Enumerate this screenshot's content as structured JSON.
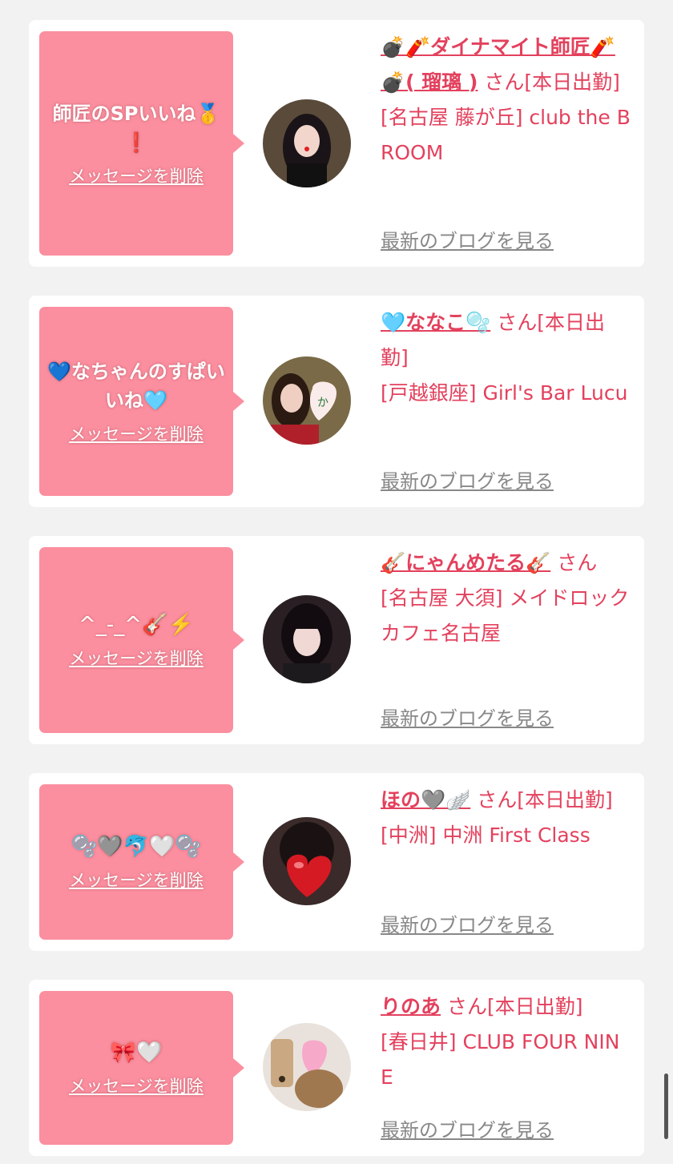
{
  "items": [
    {
      "message": "師匠のSPいいね🥇❗️",
      "delete_label": "メッセージを削除",
      "name": "💣🧨ダイナマイト師匠🧨💣( 瑠璃 )",
      "suffix": " さん[本日出勤]",
      "shop": "[名古屋 藤が丘] club the BROOM",
      "blog_label": "最新のブログを見る"
    },
    {
      "message": "💙なちゃんのすぱいいね🩵",
      "delete_label": "メッセージを削除",
      "name": "🩵ななこ🫧",
      "suffix": " さん[本日出勤]",
      "shop": "[戸越銀座] Girl's Bar Lucu",
      "blog_label": "最新のブログを見る"
    },
    {
      "message": "^_-_^🎸⚡️",
      "delete_label": "メッセージを削除",
      "name": "🎸にゃんめたる🎸",
      "suffix": " さん",
      "shop": "[名古屋 大須] メイドロックカフェ名古屋",
      "blog_label": "最新のブログを見る"
    },
    {
      "message": "🫧🩶🐬🤍🫧",
      "delete_label": "メッセージを削除",
      "name": "ほの🩶🪽",
      "suffix": " さん[本日出勤]",
      "shop": "[中洲] 中洲 First Class",
      "blog_label": "最新のブログを見る"
    },
    {
      "message": "🎀🤍",
      "delete_label": "メッセージを削除",
      "name": "りのあ",
      "suffix": " さん[本日出勤]",
      "shop": "[春日井] CLUB FOUR NINE",
      "blog_label": "最新のブログを見る"
    }
  ]
}
